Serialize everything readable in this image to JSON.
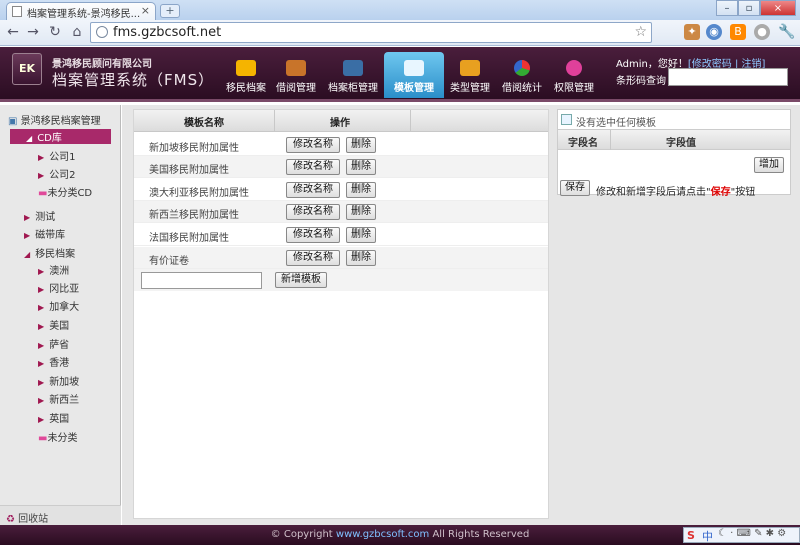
{
  "browser": {
    "tab_title": "档案管理系统-景鸿移民...",
    "tab_close": "×",
    "new_tab": "+",
    "url": "fms.gzbcsoft.net",
    "window_buttons": [
      "–",
      "▫",
      "×"
    ]
  },
  "header": {
    "logo_text": "EK",
    "company": "景鸿移民顾问有限公司",
    "system_title": "档案管理系统（FMS）",
    "nav": [
      {
        "label": "移民档案",
        "icon": "folder-icon",
        "color": "#f5b400"
      },
      {
        "label": "借阅管理",
        "icon": "briefcase-icon",
        "color": "#c8742a"
      },
      {
        "label": "档案柜管理",
        "icon": "cabinet-icon",
        "color": "#3a6ea5"
      },
      {
        "label": "模板管理",
        "icon": "template-icon",
        "color": "#2a8ec9",
        "active": true
      },
      {
        "label": "类型管理",
        "icon": "tree-icon",
        "color": "#e8a020"
      },
      {
        "label": "借阅统计",
        "icon": "pie-chart-icon",
        "color": "#3aaa3a"
      },
      {
        "label": "权限管理",
        "icon": "flower-icon",
        "color": "#e0409a"
      }
    ],
    "user_greeting": "Admin，您好！",
    "change_password": "修改密码",
    "separator": "|",
    "logout": "注销",
    "bracket_open": "[",
    "bracket_close": "]",
    "barcode_label": "条形码查询"
  },
  "sidebar": {
    "root": "景鸿移民档案管理",
    "items": [
      {
        "label": "CD库",
        "level": 1,
        "selected": true,
        "expanded": true
      },
      {
        "label": "公司1",
        "level": 2
      },
      {
        "label": "公司2",
        "level": 2
      },
      {
        "label": "未分类CD",
        "level": 2,
        "folder": true
      },
      {
        "label": "测试",
        "level": 1
      },
      {
        "label": "磁带库",
        "level": 1
      },
      {
        "label": "移民档案",
        "level": 1,
        "expanded": true
      },
      {
        "label": "澳洲",
        "level": 2
      },
      {
        "label": "冈比亚",
        "level": 2
      },
      {
        "label": "加拿大",
        "level": 2
      },
      {
        "label": "美国",
        "level": 2
      },
      {
        "label": "萨省",
        "level": 2
      },
      {
        "label": "香港",
        "level": 2
      },
      {
        "label": "新加坡",
        "level": 2
      },
      {
        "label": "新西兰",
        "level": 2
      },
      {
        "label": "英国",
        "level": 2
      },
      {
        "label": "未分类",
        "level": 2,
        "folder": true
      }
    ],
    "recycle": "回收站"
  },
  "templates": {
    "col_name": "模板名称",
    "col_ops": "操作",
    "rename_label": "修改名称",
    "delete_label": "删除",
    "rows": [
      "新加坡移民附加属性",
      "美国移民附加属性",
      "澳大利亚移民附加属性",
      "新西兰移民附加属性",
      "法国移民附加属性",
      "有价证卷"
    ],
    "new_placeholder": "",
    "add_button": "新增模板"
  },
  "fields": {
    "empty_message": "没有选中任何模板",
    "col_field_name": "字段名",
    "col_field_value": "字段值",
    "add_button": "增加",
    "save_button": "保存",
    "note_prefix": "修改和新增字段后请点击\"",
    "note_save": "保存",
    "note_suffix": "\"按钮"
  },
  "footer": {
    "prefix": "© Copyright ",
    "site": "www.gzbcsoft.com",
    "suffix": " All Rights Reserved"
  }
}
